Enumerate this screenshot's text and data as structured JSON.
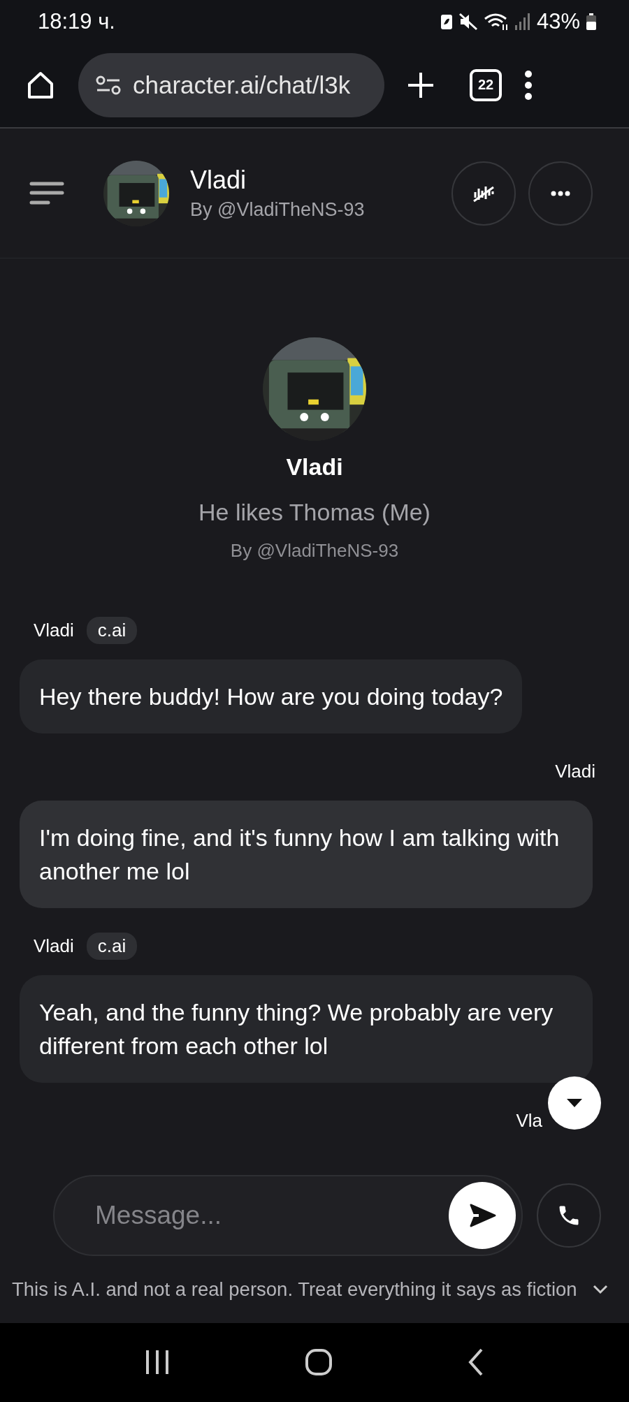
{
  "status_bar": {
    "time": "18:19 ч.",
    "battery": "43%"
  },
  "browser": {
    "url": "character.ai/chat/l3k",
    "tab_count": "22"
  },
  "header": {
    "name": "Vladi",
    "by": "By @VladiTheNS-93"
  },
  "profile": {
    "name": "Vladi",
    "tagline": "He likes Thomas (Me)",
    "by": "By @VladiTheNS-93"
  },
  "messages": [
    {
      "kind": "character",
      "author": "Vladi",
      "badge": "c.ai",
      "text": "Hey there buddy! How are you doing today?"
    },
    {
      "kind": "user",
      "author": "Vladi",
      "text": "I'm doing fine, and it's funny how I am talking with another me lol"
    },
    {
      "kind": "character",
      "author": "Vladi",
      "badge": "c.ai",
      "text": "Yeah, and the funny thing? We probably are very different from each other lol"
    },
    {
      "kind": "user",
      "author": "Vla"
    }
  ],
  "composer": {
    "placeholder": "Message..."
  },
  "disclaimer": "This is A.I. and not a real person. Treat everything it says as fiction"
}
